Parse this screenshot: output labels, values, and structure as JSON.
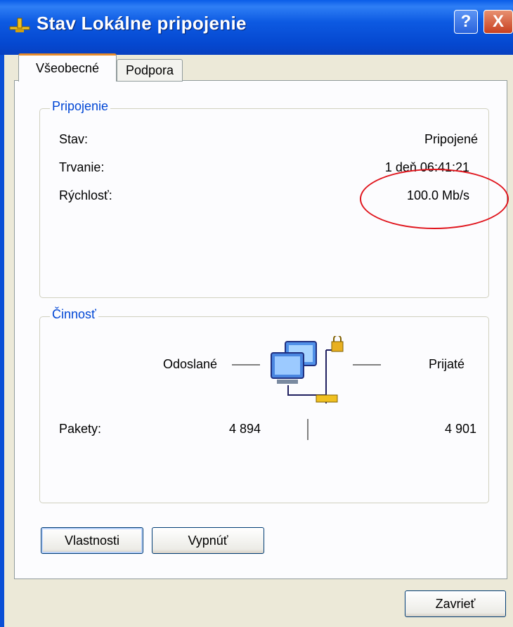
{
  "window": {
    "title": "Stav Lokálne pripojenie",
    "help_label": "?",
    "close_label": "X"
  },
  "tabs": [
    {
      "label": "Všeobecné",
      "active": true
    },
    {
      "label": "Podpora",
      "active": false
    }
  ],
  "connection": {
    "legend": "Pripojenie",
    "rows": [
      {
        "label": "Stav:",
        "value": "Pripojené"
      },
      {
        "label": "Trvanie:",
        "value": "1 deň 06:41:21"
      },
      {
        "label": "Rýchlosť:",
        "value": "100.0 Mb/s"
      }
    ]
  },
  "activity": {
    "legend": "Činnosť",
    "sent_label": "Odoslané",
    "received_label": "Prijaté",
    "packets_label": "Pakety:",
    "packets_sent": "4 894",
    "packets_received": "4 901"
  },
  "buttons": {
    "properties": "Vlastnosti",
    "disable": "Vypnúť",
    "close": "Zavrieť"
  },
  "colors": {
    "title_bar": "#0548d0",
    "tab_accent": "#e68b2c",
    "group_legend": "#0046d5",
    "annotation": "#e0141c"
  }
}
